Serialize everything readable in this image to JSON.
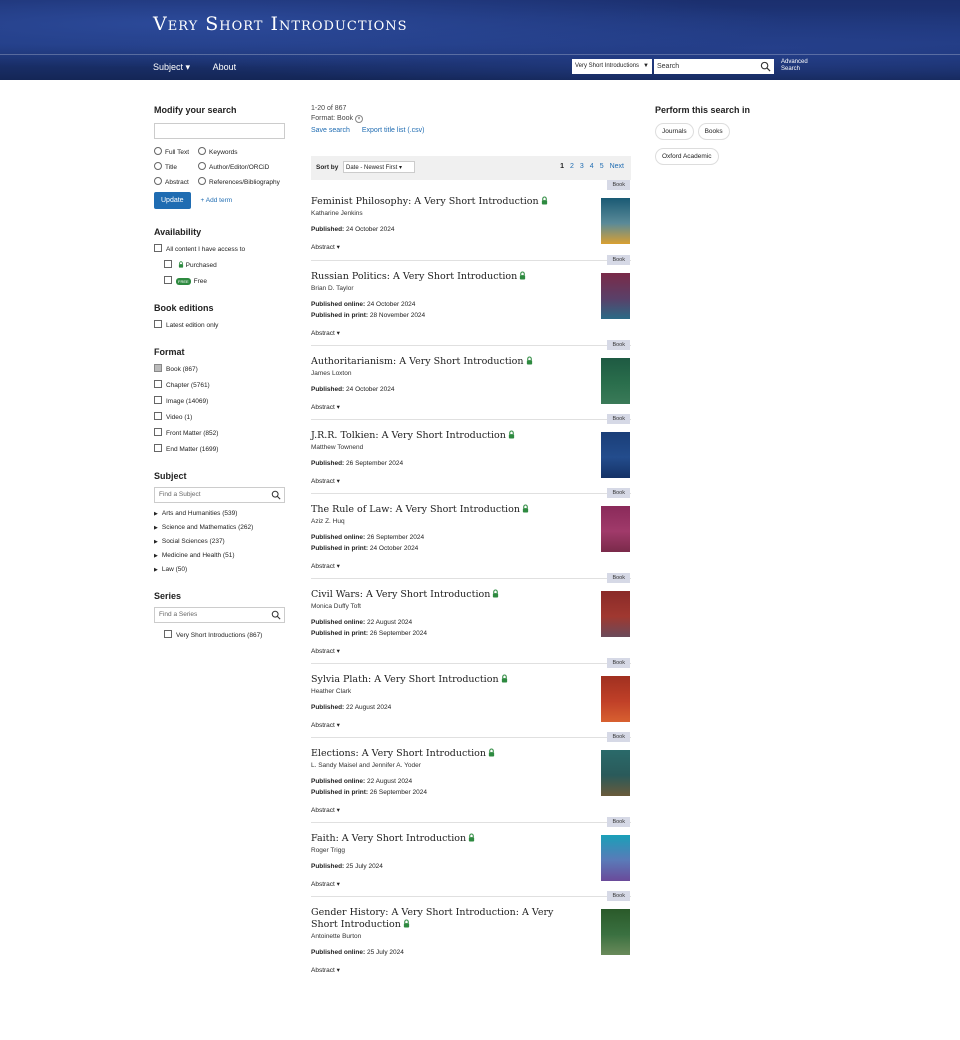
{
  "header": {
    "site_title": "Very Short Introductions",
    "nav": {
      "subject": "Subject ▾",
      "about": "About"
    },
    "search": {
      "scope": "Very Short Introductions",
      "placeholder": "Search",
      "advanced_line1": "Advanced",
      "advanced_line2": "Search"
    }
  },
  "sidebar": {
    "modify_title": "Modify your search",
    "radio_options": {
      "full_text": "Full Text",
      "keywords": "Keywords",
      "title": "Title",
      "author": "Author/Editor/ORCiD",
      "abstract": "Abstract",
      "references": "References/Bibliography"
    },
    "update_label": "Update",
    "add_term_label": "+ Add term",
    "availability": {
      "title": "Availability",
      "all_content": "All content I have access to",
      "purchased": "Purchased",
      "free_badge": "FREE",
      "free": "Free"
    },
    "editions": {
      "title": "Book editions",
      "latest": "Latest edition only"
    },
    "format": {
      "title": "Format",
      "items": [
        "Book (867)",
        "Chapter (5761)",
        "Image (14069)",
        "Video (1)",
        "Front Matter (852)",
        "End Matter (1699)"
      ]
    },
    "subject": {
      "title": "Subject",
      "placeholder": "Find a Subject",
      "items": [
        "Arts and Humanities (539)",
        "Science and Mathematics (262)",
        "Social Sciences (237)",
        "Medicine and Health (51)",
        "Law (50)"
      ]
    },
    "series": {
      "title": "Series",
      "placeholder": "Find a Series",
      "item": "Very Short Introductions (867)"
    }
  },
  "main": {
    "count": "1-20 of 867",
    "format_filter": "Format: Book",
    "save_search": "Save search",
    "export": "Export title list (.csv)",
    "sort_label": "Sort by",
    "sort_value": "Date - Newest First",
    "pages": [
      "1",
      "2",
      "3",
      "4",
      "5"
    ],
    "next": "Next",
    "badge": "Book",
    "abstract_label": "Abstract ▾",
    "results": [
      {
        "title": "Feminist Philosophy: A Very Short Introduction",
        "author": "Katharine Jenkins",
        "pub": [
          [
            "Published:",
            "24 October 2024"
          ]
        ],
        "cover": [
          "#1a5a74",
          "#5a8a98",
          "#d9a032"
        ]
      },
      {
        "title": "Russian Politics: A Very Short Introduction",
        "author": "Brian D. Taylor",
        "pub": [
          [
            "Published online:",
            "24 October 2024"
          ],
          [
            "Published in print:",
            "28 November 2024"
          ]
        ],
        "cover": [
          "#7a2a48",
          "#5a4068",
          "#2a6a86"
        ]
      },
      {
        "title": "Authoritarianism: A Very Short Introduction",
        "author": "James Loxton",
        "pub": [
          [
            "Published:",
            "24 October 2024"
          ]
        ],
        "cover": [
          "#1e5a42",
          "#2a6e4c",
          "#3a7a58"
        ]
      },
      {
        "title": "J.R.R. Tolkien: A Very Short Introduction",
        "author": "Matthew Townend",
        "pub": [
          [
            "Published:",
            "26 September 2024"
          ]
        ],
        "cover": [
          "#1a3e78",
          "#234c8c",
          "#153266"
        ]
      },
      {
        "title": "The Rule of Law: A Very Short Introduction",
        "author": "Aziz Z. Huq",
        "pub": [
          [
            "Published online:",
            "26 September 2024"
          ],
          [
            "Published in print:",
            "24 October 2024"
          ]
        ],
        "cover": [
          "#8a2a5a",
          "#a03a6a",
          "#7a2a4a"
        ]
      },
      {
        "title": "Civil Wars: A Very Short Introduction",
        "author": "Monica Duffy Toft",
        "pub": [
          [
            "Published online:",
            "22 August 2024"
          ],
          [
            "Published in print:",
            "26 September 2024"
          ]
        ],
        "cover": [
          "#8a2a28",
          "#a03830",
          "#6a4a5a"
        ]
      },
      {
        "title": "Sylvia Plath: A Very Short Introduction",
        "author": "Heather Clark",
        "pub": [
          [
            "Published:",
            "22 August 2024"
          ]
        ],
        "cover": [
          "#a03020",
          "#c04028",
          "#d86030"
        ]
      },
      {
        "title": "Elections: A Very Short Introduction",
        "author": "L. Sandy Maisel and Jennifer A. Yoder",
        "pub": [
          [
            "Published online:",
            "22 August 2024"
          ],
          [
            "Published in print:",
            "26 September 2024"
          ]
        ],
        "cover": [
          "#2a6a6a",
          "#2a5a5a",
          "#6a5a3a"
        ]
      },
      {
        "title": "Faith: A Very Short Introduction",
        "author": "Roger Trigg",
        "pub": [
          [
            "Published:",
            "25 July 2024"
          ]
        ],
        "cover": [
          "#1aa0b8",
          "#5a7ab8",
          "#6a4a9a"
        ]
      },
      {
        "title": "Gender History: A Very Short Introduction: A Very Short Introduction",
        "author": "Antoinette Burton",
        "pub": [
          [
            "Published online:",
            "25 July 2024"
          ]
        ],
        "cover": [
          "#2a5a2a",
          "#3a7040",
          "#6a8a5a"
        ]
      }
    ]
  },
  "right_panel": {
    "title": "Perform this search in",
    "chips": [
      "Journals",
      "Books",
      "Oxford Academic"
    ]
  }
}
